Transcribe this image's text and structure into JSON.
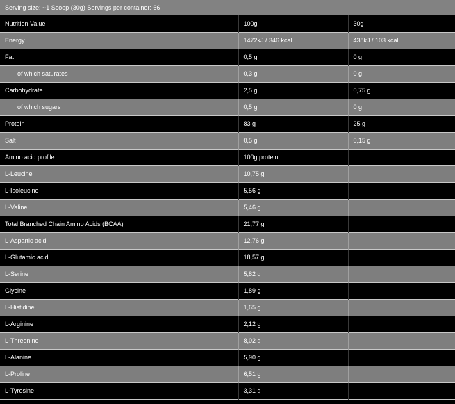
{
  "header": "Serving size: ~1 Scoop (30g) Servings per container: 66",
  "rows": [
    {
      "label": "Nutrition Value",
      "v100": "100g",
      "vserv": "30g",
      "indent": false,
      "shade": "dark"
    },
    {
      "label": "Energy",
      "v100": "1472kJ / 346 kcal",
      "vserv": "438kJ / 103 kcal",
      "indent": false,
      "shade": "light"
    },
    {
      "label": "Fat",
      "v100": "0,5 g",
      "vserv": "0 g",
      "indent": false,
      "shade": "dark"
    },
    {
      "label": "of which saturates",
      "v100": "0,3 g",
      "vserv": "0 g",
      "indent": true,
      "shade": "light"
    },
    {
      "label": "Carbohydrate",
      "v100": "2,5 g",
      "vserv": "0,75 g",
      "indent": false,
      "shade": "dark"
    },
    {
      "label": "of which sugars",
      "v100": "0,5 g",
      "vserv": "0 g",
      "indent": true,
      "shade": "light"
    },
    {
      "label": "Protein",
      "v100": "83 g",
      "vserv": "25 g",
      "indent": false,
      "shade": "dark"
    },
    {
      "label": "Salt",
      "v100": "0,5 g",
      "vserv": "0,15 g",
      "indent": false,
      "shade": "light"
    },
    {
      "label": "Amino acid profile",
      "v100": "100g protein",
      "vserv": "",
      "indent": false,
      "shade": "dark"
    },
    {
      "label": "L-Leucine",
      "v100": "10,75 g",
      "vserv": "",
      "indent": false,
      "shade": "light"
    },
    {
      "label": "L-Isoleucine",
      "v100": "5,56 g",
      "vserv": "",
      "indent": false,
      "shade": "dark"
    },
    {
      "label": "L-Valine",
      "v100": "5,46 g",
      "vserv": "",
      "indent": false,
      "shade": "light"
    },
    {
      "label": "Total Branched Chain Amino Acids (BCAA)",
      "v100": "21,77 g",
      "vserv": "",
      "indent": false,
      "shade": "dark"
    },
    {
      "label": "L-Aspartic acid",
      "v100": "12,76 g",
      "vserv": "",
      "indent": false,
      "shade": "light"
    },
    {
      "label": "L-Glutamic acid",
      "v100": "18,57 g",
      "vserv": "",
      "indent": false,
      "shade": "dark"
    },
    {
      "label": "L-Serine",
      "v100": "5,82 g",
      "vserv": "",
      "indent": false,
      "shade": "light"
    },
    {
      "label": "Glycine",
      "v100": "1,89 g",
      "vserv": "",
      "indent": false,
      "shade": "dark"
    },
    {
      "label": "L-Histidine",
      "v100": "1,65 g",
      "vserv": "",
      "indent": false,
      "shade": "light"
    },
    {
      "label": "L-Arginine",
      "v100": "2,12 g",
      "vserv": "",
      "indent": false,
      "shade": "dark"
    },
    {
      "label": "L-Threonine",
      "v100": "8,02 g",
      "vserv": "",
      "indent": false,
      "shade": "light"
    },
    {
      "label": "L-Alanine",
      "v100": "5,90 g",
      "vserv": "",
      "indent": false,
      "shade": "dark"
    },
    {
      "label": "L-Proline",
      "v100": "6,51 g",
      "vserv": "",
      "indent": false,
      "shade": "light"
    },
    {
      "label": "L-Tyrosine",
      "v100": "3,31 g",
      "vserv": "",
      "indent": false,
      "shade": "dark"
    }
  ]
}
